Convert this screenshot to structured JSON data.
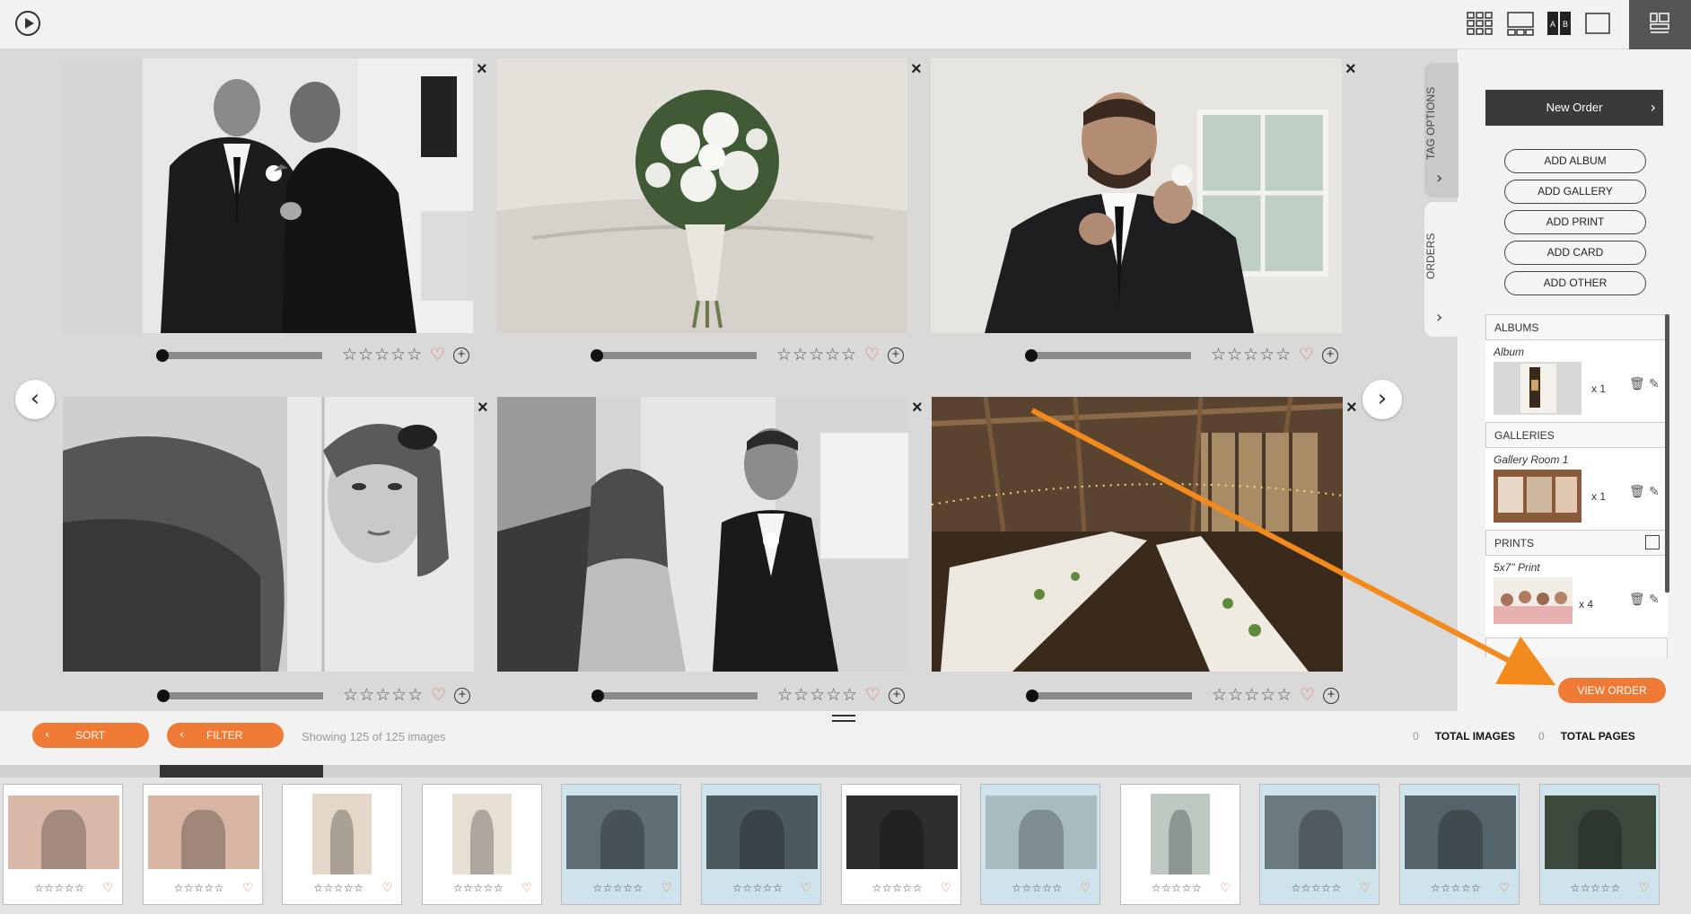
{
  "topbar": {
    "play_icon": "play-icon",
    "views": [
      "grid-view-icon",
      "compare-view-icon",
      "ab-view-icon",
      "single-view-icon"
    ],
    "ab_label_a": "A",
    "ab_label_b": "B",
    "panel_icon": "panel-toggle-icon"
  },
  "main": {
    "photos": [
      {
        "name": "groomsmen-boutonniere",
        "tone": "bw",
        "rating": 0,
        "favorite": false
      },
      {
        "name": "bridal-bouquet",
        "tone": "color",
        "rating": 0,
        "favorite": false
      },
      {
        "name": "groom-boutonniere",
        "tone": "color",
        "rating": 0,
        "favorite": false
      },
      {
        "name": "bride-makeup",
        "tone": "bw",
        "rating": 0,
        "favorite": false
      },
      {
        "name": "bride-groom-first-look",
        "tone": "bw",
        "rating": 0,
        "favorite": false
      },
      {
        "name": "barn-reception",
        "tone": "color",
        "rating": 0,
        "favorite": false
      }
    ],
    "remove_symbol": "×",
    "stars": "☆☆☆☆☆",
    "heart": "♡",
    "plus": "+",
    "prev_arrow": "‹",
    "next_arrow": "›"
  },
  "tabs": {
    "tag_options": "TAG OPTIONS",
    "orders": "ORDERS",
    "chevron": "›"
  },
  "side": {
    "new_order": "New Order",
    "new_order_arrow": "›",
    "add_buttons": [
      "ADD ALBUM",
      "ADD GALLERY",
      "ADD PRINT",
      "ADD CARD",
      "ADD OTHER"
    ],
    "sections": [
      {
        "title": "ALBUMS",
        "item": "Album",
        "qty": "x 1"
      },
      {
        "title": "GALLERIES",
        "item": "Gallery Room 1",
        "qty": "x 1"
      },
      {
        "title": "PRINTS",
        "item": "5x7\" Print",
        "qty": "x 4"
      }
    ],
    "trash_glyph": "🗑",
    "pencil_glyph": "✎",
    "view_order": "VIEW ORDER"
  },
  "bottombar": {
    "sort": "SORT",
    "filter": "FILTER",
    "pill_chevron": "‹",
    "showing": "Showing 125 of 125 images",
    "total_images_count": "0",
    "total_images_label": "TOTAL IMAGES",
    "total_pages_count": "0",
    "total_pages_label": "TOTAL PAGES"
  },
  "filmstrip": {
    "stars": "☆☆☆☆☆",
    "heart": "♡",
    "items": [
      {
        "subject": "bridesmaids-robes",
        "selected": false
      },
      {
        "subject": "bridesmaids-robes-2",
        "selected": false
      },
      {
        "subject": "bride-bouquet",
        "selected": false
      },
      {
        "subject": "bride-bouquet-2",
        "selected": false
      },
      {
        "subject": "groom-boutonniere",
        "selected": true
      },
      {
        "subject": "groomsmen-boutonniere",
        "selected": true
      },
      {
        "subject": "groom-closeup",
        "selected": false
      },
      {
        "subject": "bridal-bouquet",
        "selected": true
      },
      {
        "subject": "bouquet-portrait",
        "selected": false
      },
      {
        "subject": "bride-makeup",
        "selected": true
      },
      {
        "subject": "first-look",
        "selected": true
      },
      {
        "subject": "barn-reception",
        "selected": true
      }
    ]
  },
  "colors": {
    "accent": "#ef7a35",
    "heart": "#e26b4a",
    "selected_card": "#cfe3ec"
  }
}
